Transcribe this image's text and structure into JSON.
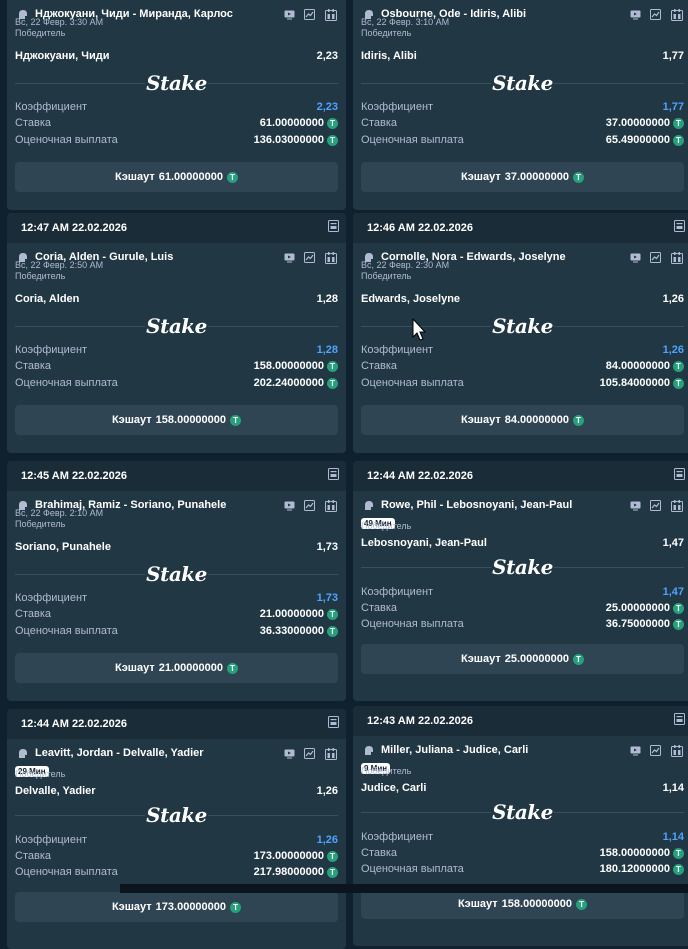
{
  "labels": {
    "winner": "Победитель",
    "odds": "Коэффициент",
    "stake": "Ставка",
    "payout": "Оценочная выплата",
    "cashout_prefix": "Кэшаут",
    "logo": "Stake",
    "coin": "T"
  },
  "colors": {
    "accent": "#4da3ff",
    "coin": "#26a17b",
    "card": "#213743",
    "header": "#1a2c38"
  },
  "cards": [
    {
      "time": "",
      "event": "Нджокуани, Чиди - Миранда, Карлос",
      "date": "Вс, 22 Февр.  3:30 AM",
      "badge": "",
      "selection": "Нджокуани, Чиди",
      "odds_display": "2,23",
      "odds_blue": "2,23",
      "stake": "61.00000000",
      "payout": "136.03000000",
      "cashout_amount": "61.00000000"
    },
    {
      "time": "",
      "event": "Osbourne, Ode - Idiris, Alibi",
      "date": "Вс, 22 Февр.  3:10 AM",
      "badge": "",
      "selection": "Idiris, Alibi",
      "odds_display": "1,77",
      "odds_blue": "1,77",
      "stake": "37.00000000",
      "payout": "65.49000000",
      "cashout_amount": "37.00000000"
    },
    {
      "time": "12:47 AM 22.02.2026",
      "event": "Coria, Alden - Gurule, Luis",
      "date": "Вс, 22 Февр.  2:50 AM",
      "badge": "",
      "selection": "Coria, Alden",
      "odds_display": "1,28",
      "odds_blue": "1,28",
      "stake": "158.00000000",
      "payout": "202.24000000",
      "cashout_amount": "158.00000000"
    },
    {
      "time": "12:46 AM 22.02.2026",
      "event": "Cornolle, Nora - Edwards, Joselyne",
      "date": "Вс, 22 Февр.  2:30 AM",
      "badge": "",
      "selection": "Edwards, Joselyne",
      "odds_display": "1,26",
      "odds_blue": "1,26",
      "stake": "84.00000000",
      "payout": "105.84000000",
      "cashout_amount": "84.00000000"
    },
    {
      "time": "12:45 AM 22.02.2026",
      "event": "Brahimaj, Ramiz - Soriano, Punahele",
      "date": "Вс, 22 Февр.  2:10 AM",
      "badge": "",
      "selection": "Soriano, Punahele",
      "odds_display": "1,73",
      "odds_blue": "1,73",
      "stake": "21.00000000",
      "payout": "36.33000000",
      "cashout_amount": "21.00000000"
    },
    {
      "time": "12:44 AM 22.02.2026",
      "event": "Rowe, Phil - Lebosnoyani, Jean-Paul",
      "date": "",
      "badge": "49 Мин",
      "selection": "Lebosnoyani, Jean-Paul",
      "odds_display": "1,47",
      "odds_blue": "1,47",
      "stake": "25.00000000",
      "payout": "36.75000000",
      "cashout_amount": "25.00000000"
    },
    {
      "time": "12:44 AM 22.02.2026",
      "event": "Leavitt, Jordan - Delvalle, Yadier",
      "date": "",
      "badge": "29 Мин",
      "selection": "Delvalle, Yadier",
      "odds_display": "1,26",
      "odds_blue": "1,26",
      "stake": "173.00000000",
      "payout": "217.98000000",
      "cashout_amount": "173.00000000"
    },
    {
      "time": "12:43 AM 22.02.2026",
      "event": "Miller, Juliana - Judice, Carli",
      "date": "",
      "badge": "9 Мин",
      "selection": "Judice, Carli",
      "odds_display": "1,14",
      "odds_blue": "1,14",
      "stake": "158.00000000",
      "payout": "180.12000000",
      "cashout_amount": "158.00000000"
    }
  ]
}
